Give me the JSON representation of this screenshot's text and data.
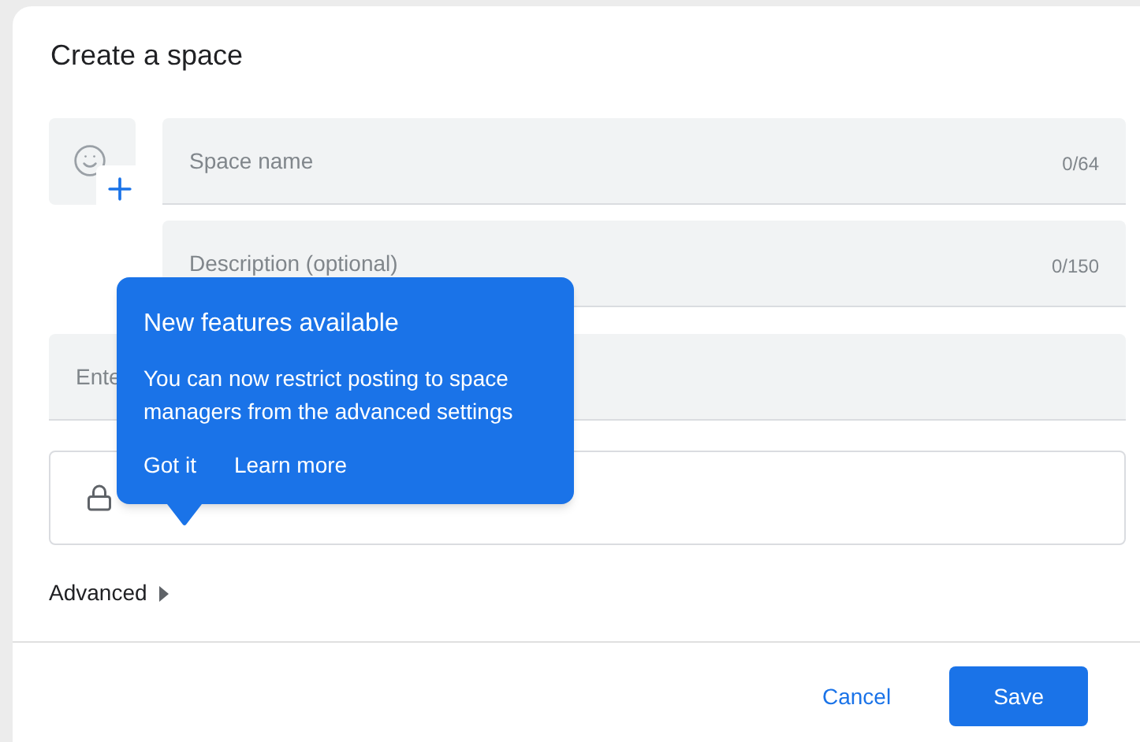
{
  "dialog": {
    "title": "Create a space"
  },
  "fields": [
    {
      "placeholder": "Space name",
      "counter": "0/64"
    },
    {
      "placeholder": "Description (optional)",
      "counter": "0/150"
    }
  ],
  "members_field": {
    "placeholder": "Ente"
  },
  "access": {
    "locked": true
  },
  "advanced": {
    "label": "Advanced",
    "expanded": false
  },
  "tooltip": {
    "title": "New features available",
    "body": "You can now restrict posting to space managers from the advanced settings",
    "actions": [
      "Got it",
      "Learn more"
    ]
  },
  "buttons": [
    {
      "label": "Cancel",
      "kind": "text"
    },
    {
      "label": "Save",
      "kind": "filled"
    }
  ]
}
